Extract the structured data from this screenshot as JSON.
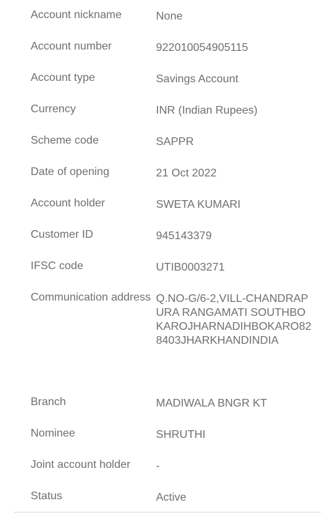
{
  "details": [
    {
      "label": "Account nickname",
      "value": "None"
    },
    {
      "label": "Account number",
      "value": "922010054905115"
    },
    {
      "label": "Account type",
      "value": "Savings Account"
    },
    {
      "label": "Currency",
      "value": "INR (Indian Rupees)"
    },
    {
      "label": "Scheme code",
      "value": "SAPPR"
    },
    {
      "label": "Date of opening",
      "value": "21 Oct 2022"
    },
    {
      "label": "Account holder",
      "value": "SWETA KUMARI"
    },
    {
      "label": "Customer ID",
      "value": "945143379"
    },
    {
      "label": "IFSC code",
      "value": "UTIB0003271"
    },
    {
      "label": "Communication address",
      "value": "Q.NO-G/6-2,VILL-CHANDRAPURA RANGAMATI SOUTHBOKAROJHARNADIHBOKARO828403JHARKHANDINDIA"
    },
    {
      "label": "Branch",
      "value": "MADIWALA BNGR KT"
    },
    {
      "label": "Nominee",
      "value": "SHRUTHI"
    },
    {
      "label": "Joint account holder",
      "value": "-"
    },
    {
      "label": "Status",
      "value": "Active"
    }
  ]
}
